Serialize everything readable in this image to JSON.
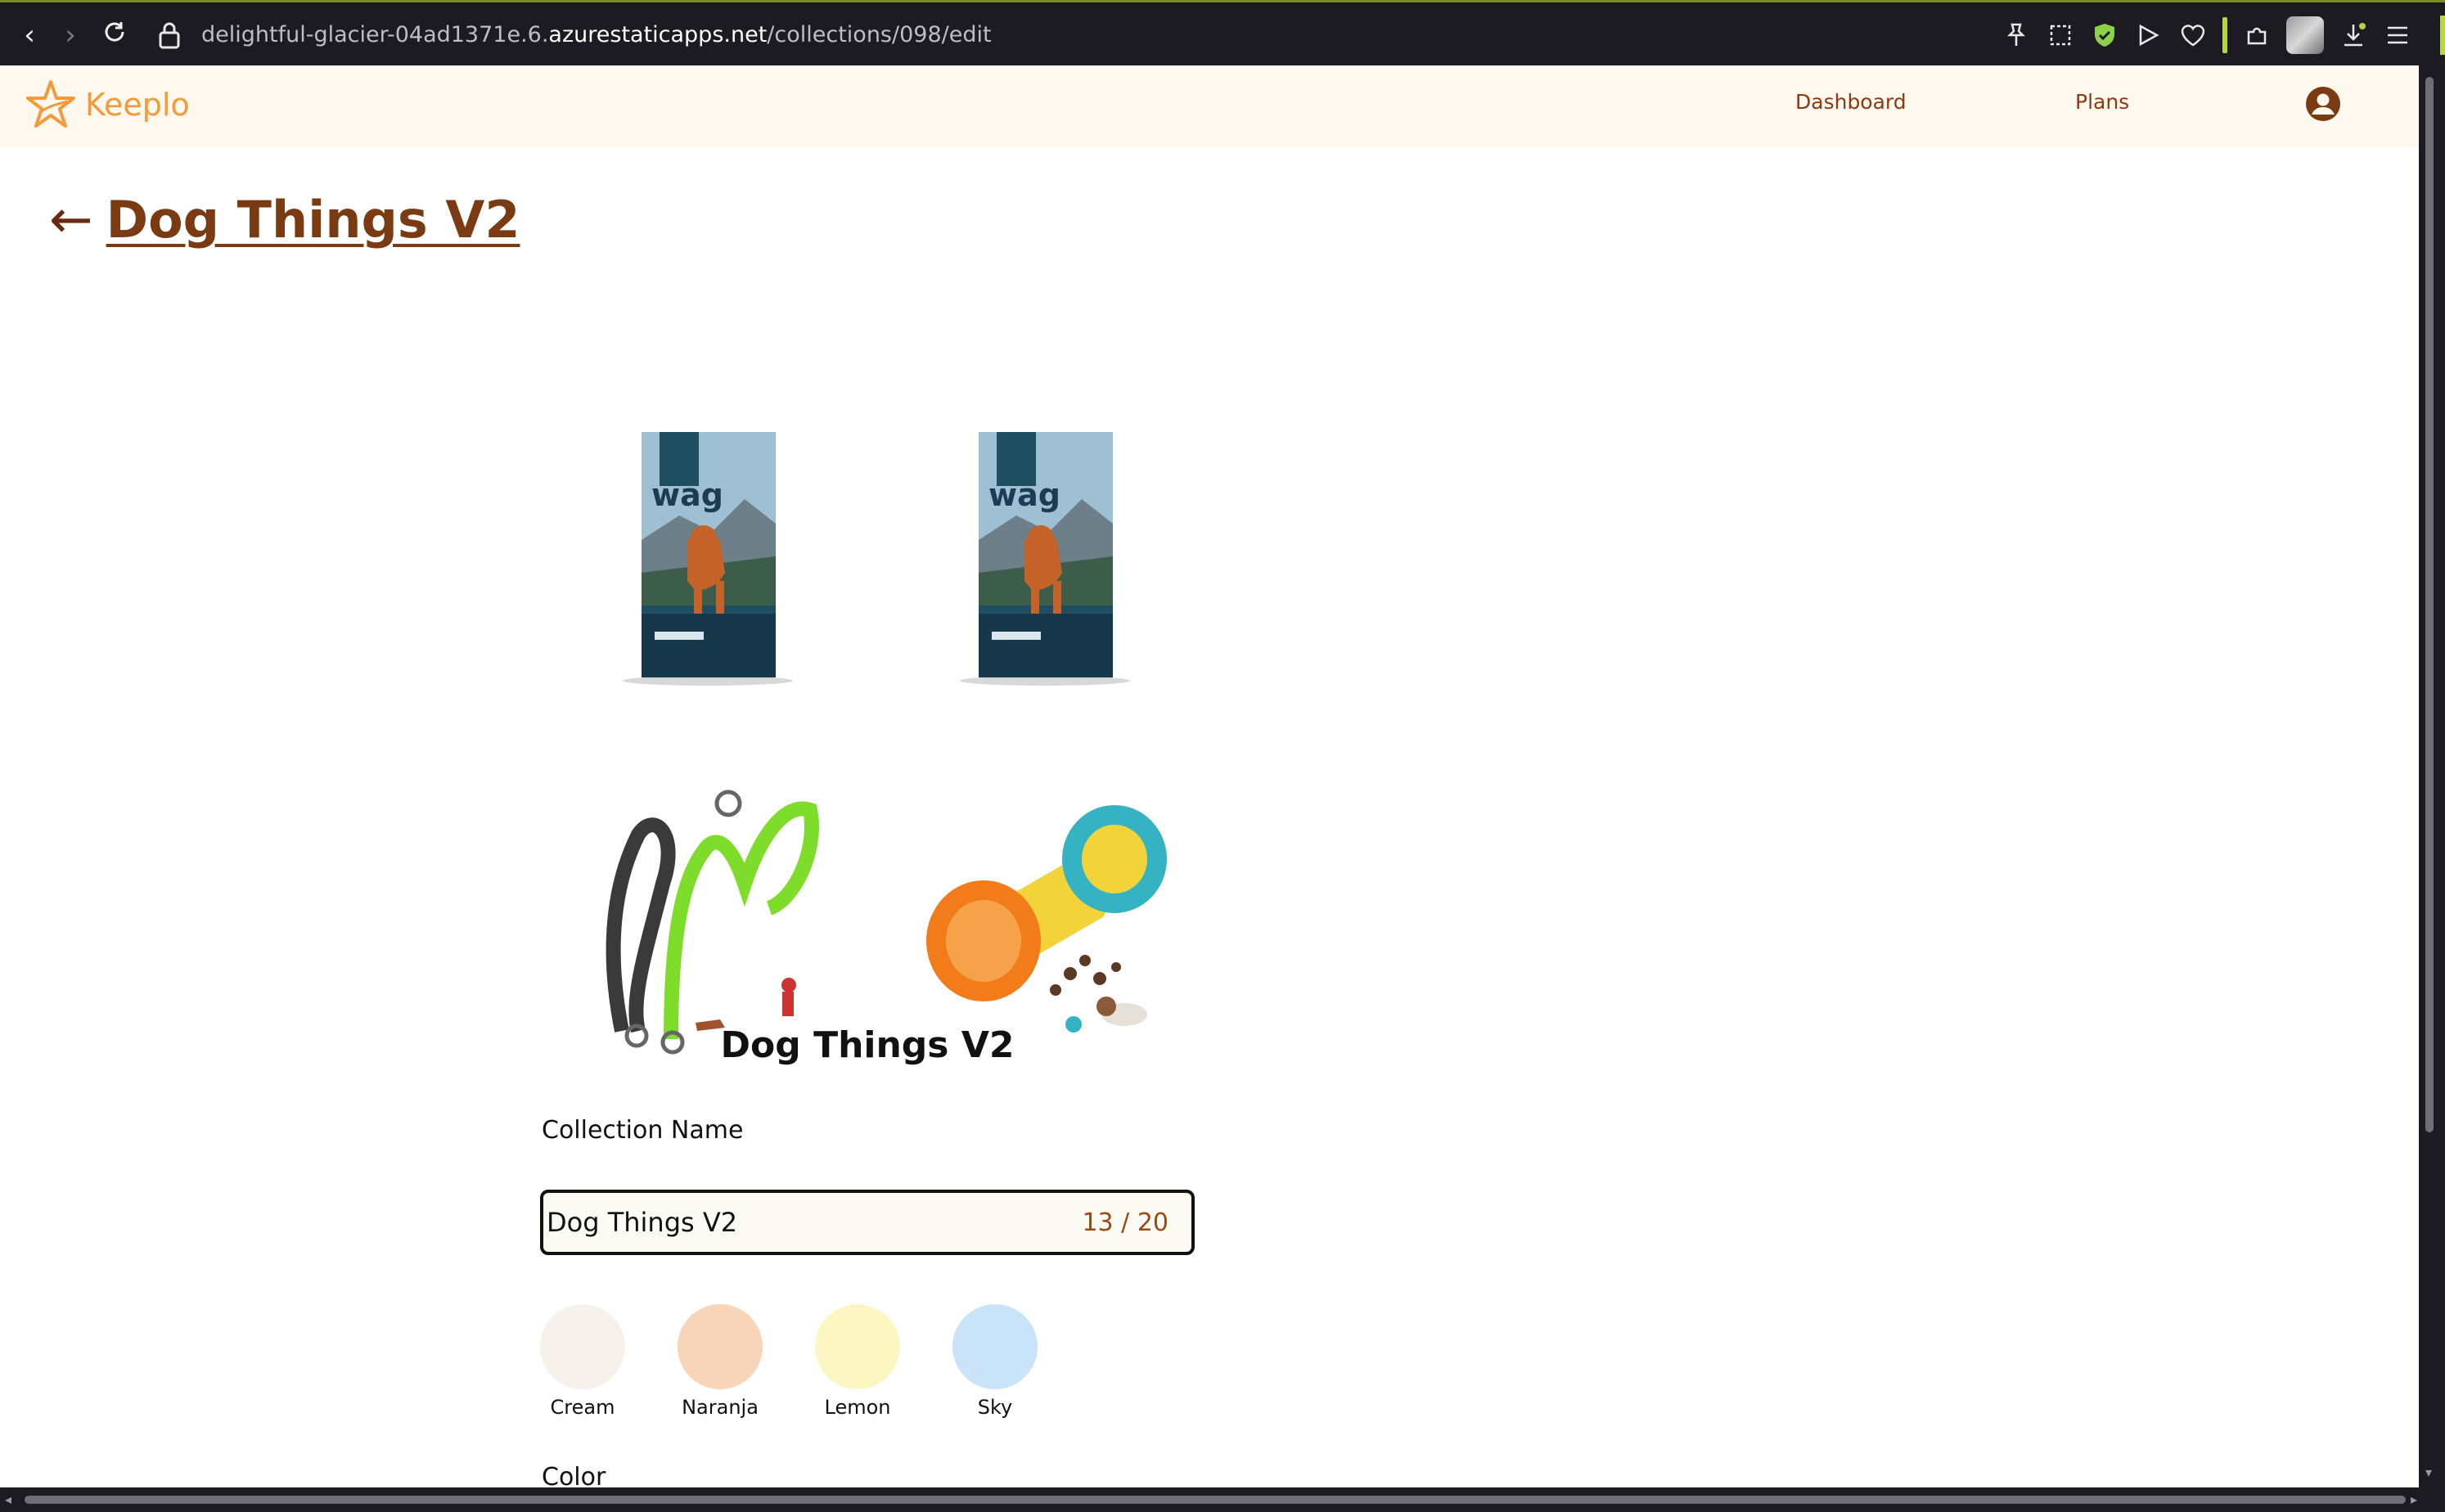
{
  "browser": {
    "url_prefix": "delightful-glacier-04ad1371e.6.",
    "url_domain": "azurestaticapps.net",
    "url_path": "/collections/098/edit"
  },
  "header": {
    "brand": "Keeplo",
    "nav": {
      "dashboard": "Dashboard",
      "plans": "Plans"
    }
  },
  "page": {
    "back_arrow": "←",
    "title": "Dog Things V2"
  },
  "products": [
    {
      "name": "wag dog food bag",
      "brand_text": "wag"
    },
    {
      "name": "wag dog food bag",
      "brand_text": "wag"
    },
    {
      "name": "double dog leash"
    },
    {
      "name": "treat dispenser toy"
    }
  ],
  "preview": {
    "title": "Dog Things V2"
  },
  "form": {
    "name_label": "Collection Name",
    "name_value": "Dog Things V2",
    "name_counter": "13 / 20",
    "color_label": "Color"
  },
  "swatches": [
    {
      "label": "Cream",
      "color": "#f6f1ea"
    },
    {
      "label": "Naranja",
      "color": "#f8d4b8"
    },
    {
      "label": "Lemon",
      "color": "#fcf6c2"
    },
    {
      "label": "Sky",
      "color": "#c9e4f8"
    }
  ],
  "colors": {
    "accent": "#f59a3a",
    "title": "#7a3a12",
    "header_bg": "#fff8ef"
  }
}
